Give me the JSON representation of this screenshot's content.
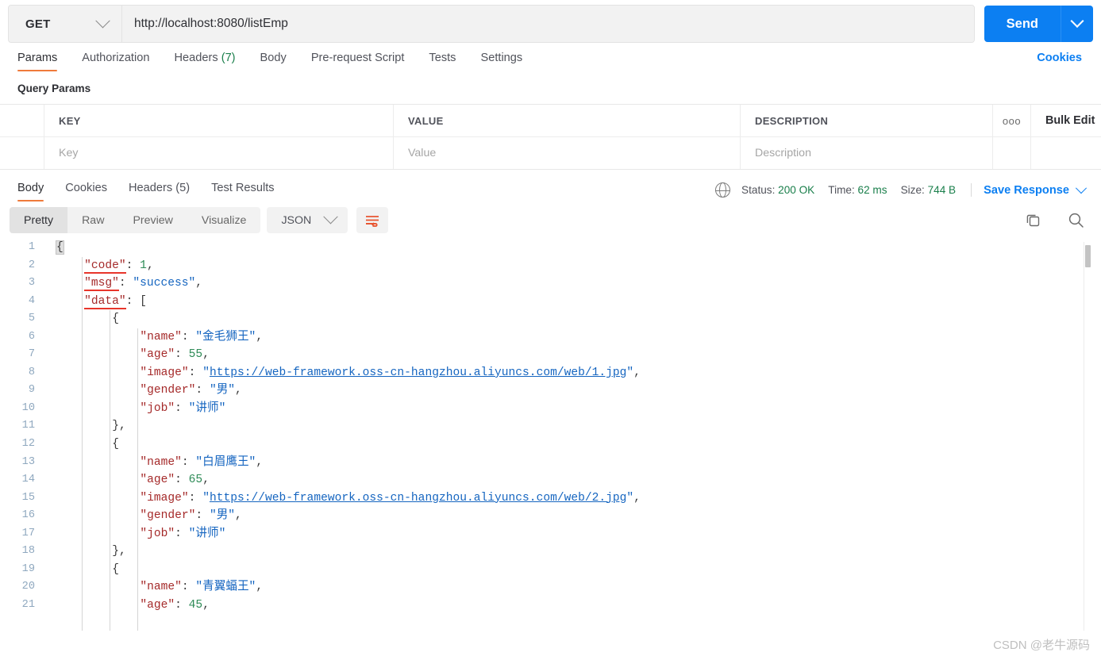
{
  "request": {
    "method": "GET",
    "url": "http://localhost:8080/listEmp",
    "send_label": "Send",
    "tabs": [
      {
        "label": "Params",
        "count": ""
      },
      {
        "label": "Authorization",
        "count": ""
      },
      {
        "label": "Headers",
        "count": "(7)"
      },
      {
        "label": "Body",
        "count": ""
      },
      {
        "label": "Pre-request Script",
        "count": ""
      },
      {
        "label": "Tests",
        "count": ""
      },
      {
        "label": "Settings",
        "count": ""
      }
    ],
    "cookies_link": "Cookies"
  },
  "query_params": {
    "title": "Query Params",
    "headers": {
      "key": "KEY",
      "value": "VALUE",
      "description": "DESCRIPTION",
      "bulk_edit": "Bulk Edit",
      "more": "ooo"
    },
    "rows": [
      {
        "key": "Key",
        "value": "Value",
        "description": "Description"
      }
    ]
  },
  "response": {
    "tabs": [
      {
        "label": "Body",
        "count": ""
      },
      {
        "label": "Cookies",
        "count": ""
      },
      {
        "label": "Headers",
        "count": "(5)"
      },
      {
        "label": "Test Results",
        "count": ""
      }
    ],
    "status_label": "Status:",
    "status_value": "200 OK",
    "time_label": "Time:",
    "time_value": "62 ms",
    "size_label": "Size:",
    "size_value": "744 B",
    "save_response": "Save Response",
    "view_modes": [
      "Pretty",
      "Raw",
      "Preview",
      "Visualize"
    ],
    "active_view": "Pretty",
    "format": "JSON"
  },
  "colors": {
    "accent_orange": "#ef7a3b",
    "link_blue": "#0c7ff2",
    "status_green": "#1a7f4b",
    "json_key": "#a52a2a",
    "json_string": "#1565c0",
    "json_number": "#2e8b57"
  },
  "body_json": {
    "code": 1,
    "msg": "success",
    "data": [
      {
        "name": "金毛狮王",
        "age": 55,
        "image": "https://web-framework.oss-cn-hangzhou.aliyuncs.com/web/1.jpg",
        "gender": "男",
        "job": "讲师"
      },
      {
        "name": "白眉鹰王",
        "age": 65,
        "image": "https://web-framework.oss-cn-hangzhou.aliyuncs.com/web/2.jpg",
        "gender": "男",
        "job": "讲师"
      },
      {
        "name": "青翼蝠王",
        "age": 45
      }
    ]
  },
  "code_lines": [
    {
      "n": 1,
      "indent": 0,
      "segs": [
        {
          "t": "{",
          "c": "brk"
        }
      ]
    },
    {
      "n": 2,
      "indent": 1,
      "segs": [
        {
          "t": "\"code\"",
          "c": "k sq"
        },
        {
          "t": ": ",
          "c": "p"
        },
        {
          "t": "1",
          "c": "n"
        },
        {
          "t": ",",
          "c": "p"
        }
      ]
    },
    {
      "n": 3,
      "indent": 1,
      "segs": [
        {
          "t": "\"msg\"",
          "c": "k sq"
        },
        {
          "t": ": ",
          "c": "p"
        },
        {
          "t": "\"success\"",
          "c": "s"
        },
        {
          "t": ",",
          "c": "p"
        }
      ]
    },
    {
      "n": 4,
      "indent": 1,
      "segs": [
        {
          "t": "\"data\"",
          "c": "k sq"
        },
        {
          "t": ": ",
          "c": "p"
        },
        {
          "t": "[",
          "c": "p"
        }
      ]
    },
    {
      "n": 5,
      "indent": 2,
      "segs": [
        {
          "t": "{",
          "c": "p"
        }
      ]
    },
    {
      "n": 6,
      "indent": 3,
      "segs": [
        {
          "t": "\"name\"",
          "c": "k"
        },
        {
          "t": ": ",
          "c": "p"
        },
        {
          "t": "\"金毛狮王\"",
          "c": "s"
        },
        {
          "t": ",",
          "c": "p"
        }
      ]
    },
    {
      "n": 7,
      "indent": 3,
      "segs": [
        {
          "t": "\"age\"",
          "c": "k"
        },
        {
          "t": ": ",
          "c": "p"
        },
        {
          "t": "55",
          "c": "n"
        },
        {
          "t": ",",
          "c": "p"
        }
      ]
    },
    {
      "n": 8,
      "indent": 3,
      "segs": [
        {
          "t": "\"image\"",
          "c": "k"
        },
        {
          "t": ": ",
          "c": "p"
        },
        {
          "t": "\"",
          "c": "s"
        },
        {
          "t": "https://web-framework.oss-cn-hangzhou.aliyuncs.com/web/1.jpg",
          "c": "u"
        },
        {
          "t": "\"",
          "c": "s"
        },
        {
          "t": ",",
          "c": "p"
        }
      ]
    },
    {
      "n": 9,
      "indent": 3,
      "segs": [
        {
          "t": "\"gender\"",
          "c": "k"
        },
        {
          "t": ": ",
          "c": "p"
        },
        {
          "t": "\"男\"",
          "c": "s"
        },
        {
          "t": ",",
          "c": "p"
        }
      ]
    },
    {
      "n": 10,
      "indent": 3,
      "segs": [
        {
          "t": "\"job\"",
          "c": "k"
        },
        {
          "t": ": ",
          "c": "p"
        },
        {
          "t": "\"讲师\"",
          "c": "s"
        }
      ]
    },
    {
      "n": 11,
      "indent": 2,
      "segs": [
        {
          "t": "},",
          "c": "p"
        }
      ]
    },
    {
      "n": 12,
      "indent": 2,
      "segs": [
        {
          "t": "{",
          "c": "p"
        }
      ]
    },
    {
      "n": 13,
      "indent": 3,
      "segs": [
        {
          "t": "\"name\"",
          "c": "k"
        },
        {
          "t": ": ",
          "c": "p"
        },
        {
          "t": "\"白眉鹰王\"",
          "c": "s"
        },
        {
          "t": ",",
          "c": "p"
        }
      ]
    },
    {
      "n": 14,
      "indent": 3,
      "segs": [
        {
          "t": "\"age\"",
          "c": "k"
        },
        {
          "t": ": ",
          "c": "p"
        },
        {
          "t": "65",
          "c": "n"
        },
        {
          "t": ",",
          "c": "p"
        }
      ]
    },
    {
      "n": 15,
      "indent": 3,
      "segs": [
        {
          "t": "\"image\"",
          "c": "k"
        },
        {
          "t": ": ",
          "c": "p"
        },
        {
          "t": "\"",
          "c": "s"
        },
        {
          "t": "https://web-framework.oss-cn-hangzhou.aliyuncs.com/web/2.jpg",
          "c": "u"
        },
        {
          "t": "\"",
          "c": "s"
        },
        {
          "t": ",",
          "c": "p"
        }
      ]
    },
    {
      "n": 16,
      "indent": 3,
      "segs": [
        {
          "t": "\"gender\"",
          "c": "k"
        },
        {
          "t": ": ",
          "c": "p"
        },
        {
          "t": "\"男\"",
          "c": "s"
        },
        {
          "t": ",",
          "c": "p"
        }
      ]
    },
    {
      "n": 17,
      "indent": 3,
      "segs": [
        {
          "t": "\"job\"",
          "c": "k"
        },
        {
          "t": ": ",
          "c": "p"
        },
        {
          "t": "\"讲师\"",
          "c": "s"
        }
      ]
    },
    {
      "n": 18,
      "indent": 2,
      "segs": [
        {
          "t": "},",
          "c": "p"
        }
      ]
    },
    {
      "n": 19,
      "indent": 2,
      "segs": [
        {
          "t": "{",
          "c": "p"
        }
      ]
    },
    {
      "n": 20,
      "indent": 3,
      "segs": [
        {
          "t": "\"name\"",
          "c": "k"
        },
        {
          "t": ": ",
          "c": "p"
        },
        {
          "t": "\"青翼蝠王\"",
          "c": "s"
        },
        {
          "t": ",",
          "c": "p"
        }
      ]
    },
    {
      "n": 21,
      "indent": 3,
      "segs": [
        {
          "t": "\"age\"",
          "c": "k"
        },
        {
          "t": ": ",
          "c": "p"
        },
        {
          "t": "45",
          "c": "n"
        },
        {
          "t": ",",
          "c": "p"
        }
      ]
    }
  ],
  "watermark": "CSDN @老牛源码"
}
